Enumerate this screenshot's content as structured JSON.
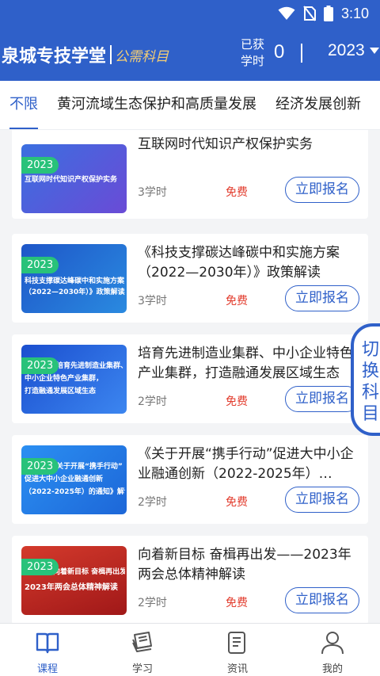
{
  "status_bar": {
    "time": "3:10"
  },
  "header": {
    "app_title": "泉城专技学堂",
    "app_subtitle": "公需科目",
    "hours_label": "已获学时",
    "hours_value": "0",
    "year": "2023"
  },
  "tabs": [
    {
      "label": "不限",
      "active": true
    },
    {
      "label": "黄河流域生态保护和高质量发展",
      "active": false
    },
    {
      "label": "经济发展创新",
      "active": false
    }
  ],
  "courses": [
    {
      "badge": "2023",
      "thumb_lines": [
        "互联网时代知识产权保护实务"
      ],
      "title": "互联网时代知识产权保护实务",
      "hours": "3学时",
      "price": "免费",
      "action": "立即报名"
    },
    {
      "badge": "2023",
      "thumb_lines": [
        "科技支撑碳达峰碳中和实施方案",
        "（2022—2030年）》政策解读"
      ],
      "title": "《科技支撑碳达峰碳中和实施方案（2022—2030年）》政策解读",
      "hours": "3学时",
      "price": "免费",
      "action": "立即报名"
    },
    {
      "badge": "2023",
      "thumb_lines": [
        "培育先进制造业集群、",
        "中小企业特色产业集群，",
        "打造融通发展区域生态"
      ],
      "title": "培育先进制造业集群、中小企业特色产业集群，打造融通发展区域生态",
      "hours": "2学时",
      "price": "免费",
      "action": "立即报名"
    },
    {
      "badge": "2023",
      "thumb_lines": [
        "关于开展“携手行动”",
        "促进大中小企业融通创新",
        "（2022-2025年）的通知》解读"
      ],
      "title": "《关于开展“携手行动”促进大中小企业融通创新（2022-2025年）…",
      "hours": "2学时",
      "price": "免费",
      "action": "立即报名"
    },
    {
      "badge": "2023",
      "thumb_lines": [
        "向着新目标 奋楫再出发——",
        "2023年两会总体精神解读"
      ],
      "title": "向着新目标 奋楫再出发——2023年两会总体精神解读",
      "hours": "2学时",
      "price": "免费",
      "action": "立即报名"
    }
  ],
  "switch_button": {
    "chars": [
      "切",
      "换",
      "科",
      "目"
    ]
  },
  "bottom_nav": [
    {
      "label": "课程",
      "icon": "book-open-icon",
      "active": true
    },
    {
      "label": "学习",
      "icon": "books-stack-icon",
      "active": false
    },
    {
      "label": "资讯",
      "icon": "news-document-icon",
      "active": false
    },
    {
      "label": "我的",
      "icon": "person-icon",
      "active": false
    }
  ],
  "colors": {
    "primary": "#2f60c9",
    "badge": "#28c27a",
    "price": "#e23b2c",
    "subtitle_gold": "#f3cd75"
  }
}
